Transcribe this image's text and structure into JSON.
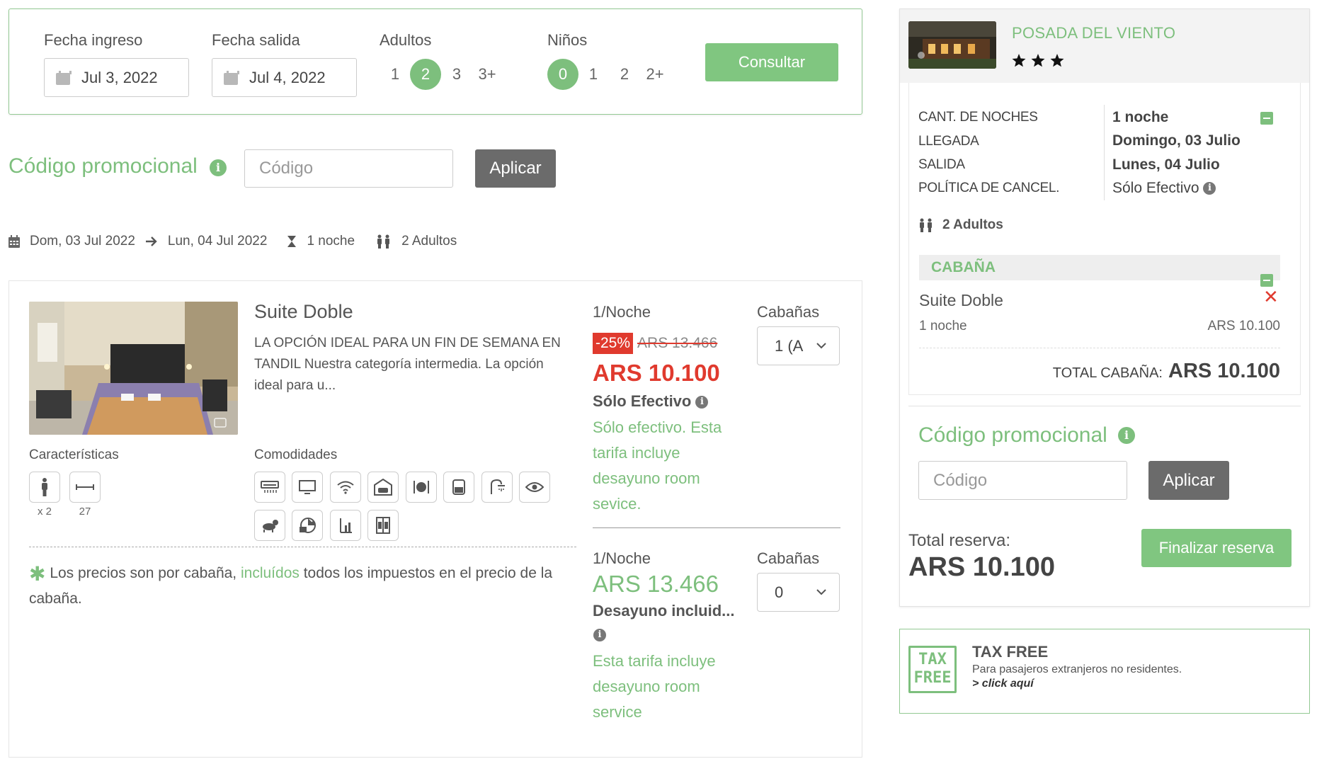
{
  "search": {
    "checkin_label": "Fecha ingreso",
    "checkin_value": "Jul 3, 2022",
    "checkout_label": "Fecha salida",
    "checkout_value": "Jul 4, 2022",
    "adults_label": "Adultos",
    "adults_options": [
      "1",
      "2",
      "3",
      "3+"
    ],
    "adults_selected": "2",
    "kids_label": "Niños",
    "kids_options": [
      "0",
      "1",
      "2",
      "2+"
    ],
    "kids_selected": "0",
    "submit_label": "Consultar"
  },
  "promo": {
    "title": "Código promocional",
    "placeholder": "Código",
    "apply_label": "Aplicar"
  },
  "summary": {
    "from": "Dom, 03 Jul 2022",
    "to": "Lun, 04 Jul 2022",
    "nights": "1 noche",
    "guests": "2 Adultos"
  },
  "room": {
    "name": "Suite Doble",
    "description": "LA OPCIÓN IDEAL PARA UN FIN DE SEMANA EN TANDIL Nuestra categoría intermedia. La opción ideal para u...",
    "features_label": "Características",
    "features": [
      {
        "icon": "person-icon",
        "value": "x 2"
      },
      {
        "icon": "size-icon",
        "value": "27"
      }
    ],
    "amenities_label": "Comodidades",
    "amenities": [
      "air-conditioner-icon",
      "tv-icon",
      "wifi-icon",
      "garage-icon",
      "restaurant-icon",
      "minibar-icon",
      "shower-icon",
      "view-icon",
      "pet-icon",
      "breakfast-icon",
      "park-icon",
      "wardrobe-icon"
    ],
    "footnote_pre": "Los precios son por cabaña, ",
    "footnote_link": "incluídos",
    "footnote_post": " todos los impuestos en el precio de la cabaña.",
    "rates": [
      {
        "per_night": "1/Noche",
        "discount": "-25%",
        "old_price": "ARS 13.466",
        "price": "ARS 10.100",
        "rate_name": "Sólo Efectivo",
        "rate_desc": "Sólo efectivo. Esta tarifa incluye desayuno room sevice.",
        "units_label": "Cabañas",
        "units_value": "1 (A"
      },
      {
        "per_night": "1/Noche",
        "price": "ARS 13.466",
        "rate_name": "Desayuno incluid...",
        "rate_desc": "Esta tarifa incluye desayuno room service",
        "units_label": "Cabañas",
        "units_value": "0"
      }
    ]
  },
  "cart": {
    "hotel_name": "POSADA DEL VIENTO",
    "stars": 3,
    "details": [
      {
        "label": "CANT. DE NOCHES",
        "value": "1 noche"
      },
      {
        "label": "LLEGADA",
        "value": "Domingo, 03 Julio"
      },
      {
        "label": "SALIDA",
        "value": "Lunes, 04 Julio"
      },
      {
        "label": "POLÍTICA DE CANCEL.",
        "value": "Sólo Efectivo"
      }
    ],
    "guests": "2 Adultos",
    "section_title": "CABAÑA",
    "item_name": "Suite Doble",
    "item_nights": "1 noche",
    "item_price": "ARS 10.100",
    "total_cabin_label": "TOTAL CABAÑA:",
    "total_cabin_value": "ARS 10.100",
    "promo_title": "Código promocional",
    "promo_placeholder": "Código",
    "promo_apply": "Aplicar",
    "total_label": "Total reserva:",
    "total_value": "ARS 10.100",
    "finish_label": "Finalizar reserva"
  },
  "taxfree": {
    "logo_line1": "TAX",
    "logo_line2": "FREE",
    "title": "TAX FREE",
    "subtitle": "Para pasajeros extranjeros no residentes.",
    "link": "> click aquí"
  },
  "colors": {
    "accent": "#7dbf7d",
    "price_red": "#e03a2e",
    "button_gray": "#6b6b6b"
  }
}
